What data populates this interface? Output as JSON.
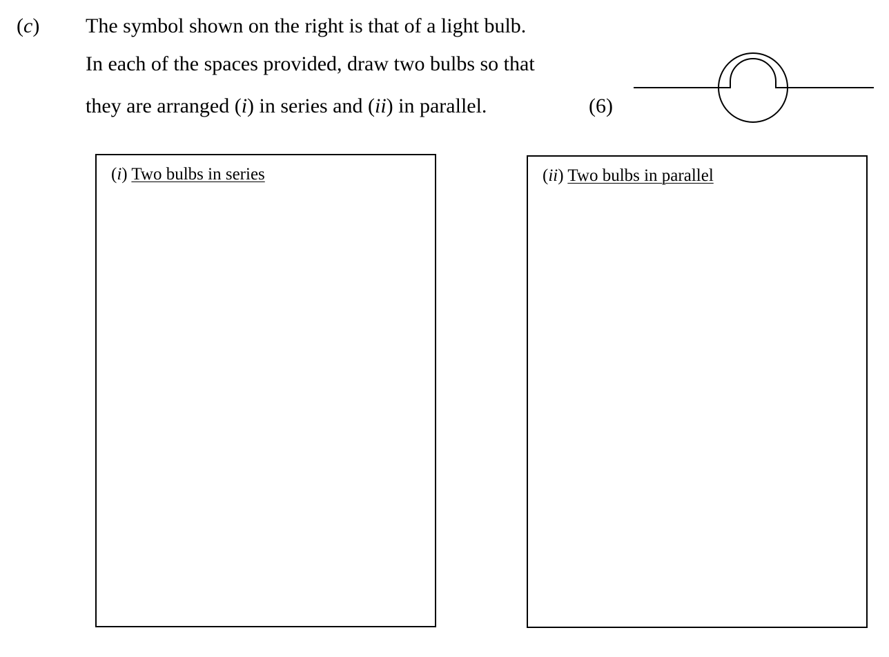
{
  "question": {
    "part_label": "c",
    "line1": "The symbol shown on the right is that of a light bulb.",
    "line2": "In each of the spaces provided, draw two bulbs so that",
    "line3_before": "they are arranged (",
    "line3_i": "i",
    "line3_mid": ") in series and (",
    "line3_ii": "ii",
    "line3_after": ") in parallel.",
    "marks": "(6)"
  },
  "boxes": {
    "series": {
      "numeral": "i",
      "title": "Two bulbs in series"
    },
    "parallel": {
      "numeral": "ii",
      "title": "Two bulbs in parallel"
    }
  },
  "icons": {
    "bulb_symbol": "light-bulb-circuit-symbol-icon"
  }
}
